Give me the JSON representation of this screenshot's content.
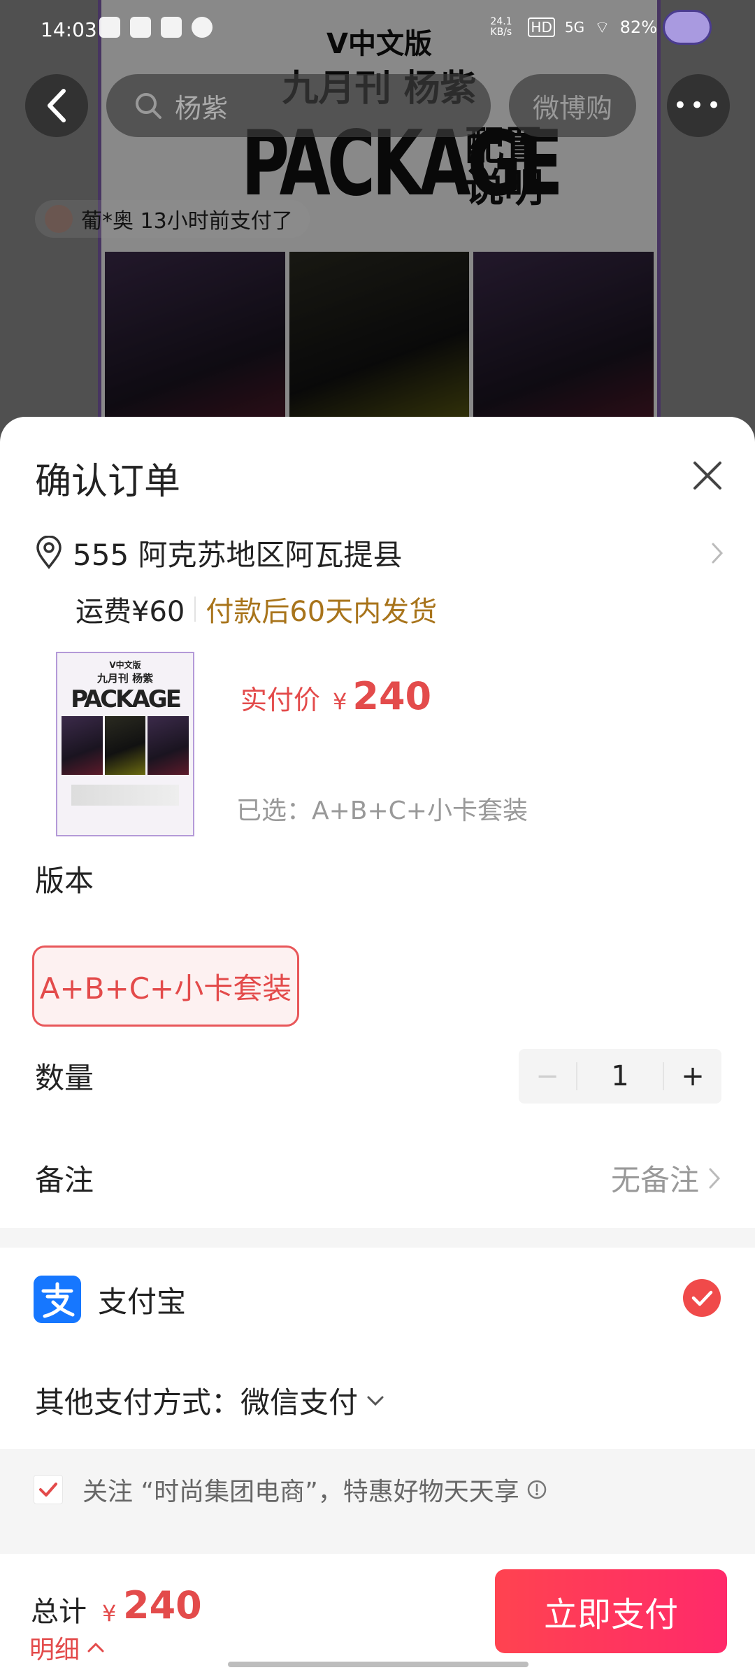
{
  "status_bar": {
    "time": "14:03",
    "net_speed": "24.1 KB/s",
    "hd": "HD",
    "signal": "5G",
    "battery": "82%"
  },
  "background": {
    "search_text": "杨紫",
    "weibo_buy": "微博购",
    "poster": {
      "line1": "V中文版",
      "line2": "九月刊 杨紫",
      "line3": "PACKAGE",
      "line4": "配置说明"
    },
    "paid_notice": "葡*奥 13小时前支付了"
  },
  "sheet": {
    "title": "确认订单",
    "address": "555 阿克苏地区阿瓦提县",
    "shipping_fee": "运费¥60",
    "shipping_note": "付款后60天内发货",
    "thumb": {
      "line1": "V中文版",
      "line2": "九月刊 杨紫",
      "line3": "PACKAGE"
    },
    "price_label": "实付价",
    "currency": "¥",
    "price": "240",
    "selected": "已选：A+B+C+小卡套装",
    "version_label": "版本",
    "version_option": "A+B+C+小卡套装",
    "quantity_label": "数量",
    "quantity_minus": "−",
    "quantity": "1",
    "quantity_plus": "+",
    "remark_label": "备注",
    "remark_value": "无备注",
    "alipay_label": "支付宝",
    "other_payment": "其他支付方式：微信支付",
    "follow_text": "关注 “时尚集团电商”，特惠好物天天享",
    "follow_checked": true
  },
  "footer": {
    "total_label": "总计",
    "currency": "¥",
    "total": "240",
    "detail_link": "明细",
    "pay_button": "立即支付"
  },
  "colors": {
    "accent_red": "#e34b4b",
    "ship_note": "#a8741b",
    "alipay_blue": "#1677ff",
    "pay_gradient_start": "#ff4350",
    "pay_gradient_end": "#ff2a6a"
  }
}
